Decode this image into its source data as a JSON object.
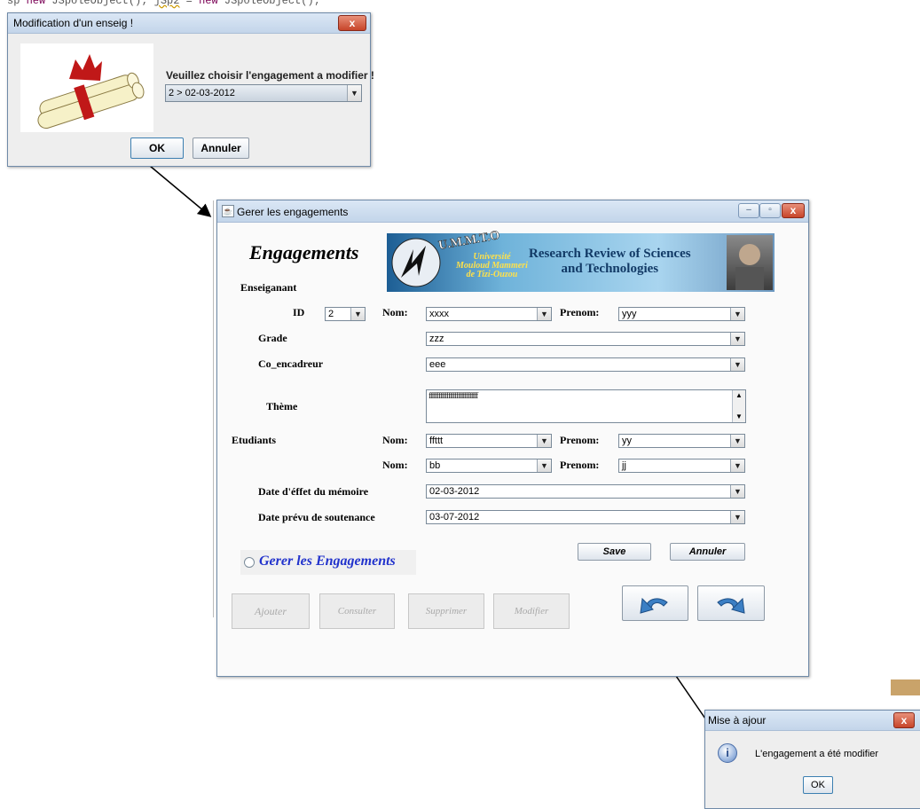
{
  "background_code": {
    "text_a": "sp   ",
    "kw_a": "new",
    "text_b": " JSpoleObject(); ",
    "text_c": "jSp2",
    "text_d": " = ",
    "kw_b": "new",
    "text_e": " JSpoleObject();"
  },
  "dialog_select": {
    "title": "Modification d'un enseig !",
    "prompt": "Veuillez choisir l'engagement a modifier !",
    "selected": "2 > 02-03-2012",
    "ok": "OK",
    "cancel": "Annuler",
    "close": "x"
  },
  "main": {
    "title": "Gerer les engagements",
    "heading": "Engagements",
    "banner": {
      "top": "U.M.M.T.O",
      "univ1": "Université",
      "univ2": "Mouloud Mammeri",
      "univ3": "de Tizi-Ouzou",
      "review1": "Research Review of Sciences",
      "review2": "and Technologies"
    },
    "section_teacher": "Enseiganant",
    "id_label": "ID",
    "id_value": "2",
    "nom_label": "Nom:",
    "prenom_label": "Prenom:",
    "teacher_nom": "xxxx",
    "teacher_prenom": "yyy",
    "grade_label": "Grade",
    "grade_value": "zzz",
    "coenc_label": "Co_encadreur",
    "coenc_value": "eee",
    "theme_label": "Thème",
    "theme_value": "ffffffffffffffffffffffffffffff",
    "section_students": "Etudiants",
    "student1_nom": "ffttt",
    "student1_prenom": "yy",
    "student2_nom": "bb",
    "student2_prenom": "jj",
    "date_effet_label": "Date d'éffet du mémoire",
    "date_effet_value": "02-03-2012",
    "date_prevu_label": "Date prévu de soutenance",
    "date_prevu_value": "03-07-2012",
    "save": "Save",
    "annuler": "Annuler",
    "radio_label": "Gerer les Engagements",
    "btn_ajouter": "Ajouter",
    "btn_consulter": "Consulter",
    "btn_supprimer": "Supprimer",
    "btn_modifier": "Modifier"
  },
  "dialog_info": {
    "title": "Mise à ajour",
    "message": "L'engagement a été modifier",
    "ok": "OK",
    "close": "x"
  },
  "colors": {
    "accent_italic": "#2233cc",
    "banner_bg": "#3a6fa8"
  }
}
